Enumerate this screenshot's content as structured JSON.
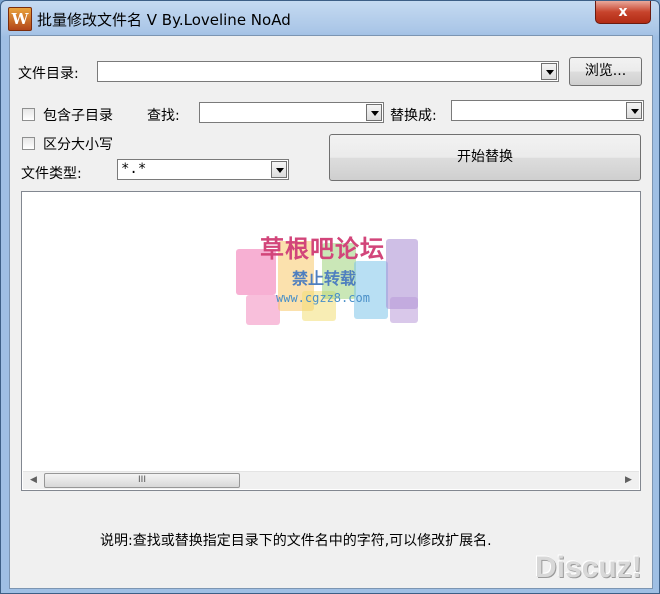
{
  "window": {
    "title": "批量修改文件名 V   By.Loveline  NoAd",
    "icon_letter": "W",
    "close_label": "x"
  },
  "form": {
    "dir_label": "文件目录:",
    "dir_value": "",
    "browse_label": "浏览...",
    "subdir_label": "包含子目录",
    "subdir_checked": false,
    "find_label": "查找:",
    "find_value": "",
    "replace_label": "替换成:",
    "replace_value": "",
    "case_label": "区分大小写",
    "case_checked": false,
    "type_label": "文件类型:",
    "type_value": "*.*",
    "start_label": "开始替换"
  },
  "list": {
    "scroll_thumb_glyph": "III"
  },
  "watermark": {
    "title": "草根吧论坛",
    "subtitle": "禁止转载",
    "url": "www.cgzz8.com"
  },
  "note": "说明:查找或替换指定目录下的文件名中的字符,可以修改扩展名.",
  "corner_watermark": "Discuz!",
  "colors": {
    "close_button": "#c7432c",
    "title_bar": "#aac6e7"
  }
}
